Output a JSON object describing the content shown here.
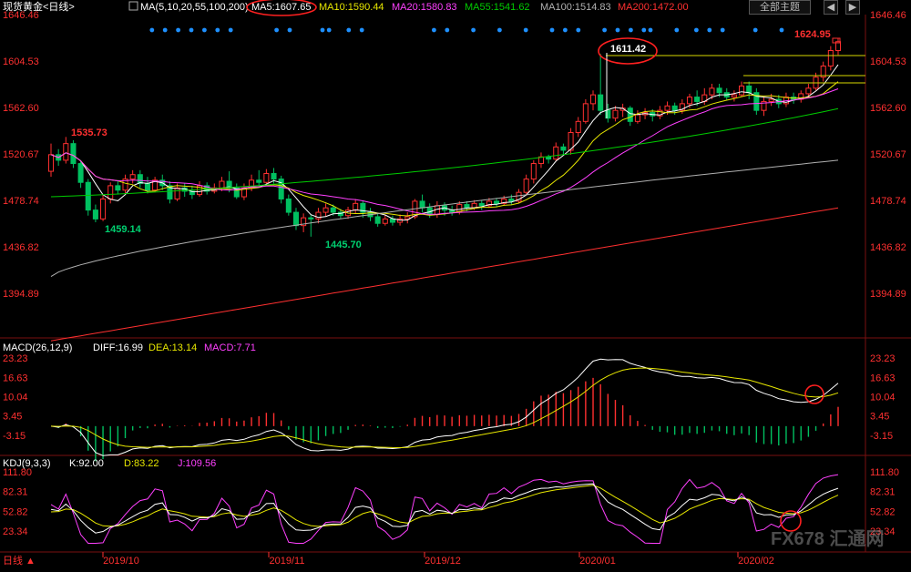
{
  "header": {
    "title": "现货黄金<日线>",
    "ma_indicator": "MA(5,10,20,55,100,200)",
    "ma_values": [
      {
        "text": "MA5:1607.65",
        "color": "#ffffff"
      },
      {
        "text": "MA10:1590.44",
        "color": "#e6e600"
      },
      {
        "text": "MA20:1580.83",
        "color": "#ff40ff"
      },
      {
        "text": "MA55:1541.62",
        "color": "#00cc00"
      },
      {
        "text": "MA100:1514.83",
        "color": "#b0b0b0"
      },
      {
        "text": "MA200:1472.00",
        "color": "#ff3030"
      }
    ],
    "theme_button": "全部主题",
    "nav_left": "◀",
    "nav_right": "▶"
  },
  "macd_header": {
    "name": "MACD(26,12,9)",
    "diff": "DIFF:16.99",
    "dea": "DEA:13.14",
    "macd": "MACD:7.71"
  },
  "kdj_header": {
    "name": "KDJ(9,3,3)",
    "k": "K:92.00",
    "d": "D:83.22",
    "j": "J:109.56"
  },
  "footer": {
    "period": "日线 ▲",
    "watermark": "FX678 汇通网"
  },
  "colors": {
    "up": "#ff3030",
    "down": "#00c060",
    "ma5": "#ffffff",
    "ma10": "#e6e600",
    "ma20": "#ff40ff",
    "ma55": "#00cc00",
    "ma100": "#b0b0b0",
    "ma200": "#ff3030",
    "axis": "#ff3030",
    "annot": "#ff3030"
  },
  "chart_data": [
    {
      "type": "candlestick",
      "title": "现货黄金<日线>",
      "y_ticks": [
        1646.46,
        1604.53,
        1562.6,
        1520.67,
        1478.74,
        1436.82,
        1394.89
      ],
      "x_ticks": [
        "2019/10",
        "2019/11",
        "2019/12",
        "2020/01",
        "2020/02"
      ],
      "annotations": [
        {
          "label": "1535.73"
        },
        {
          "label": "1459.14"
        },
        {
          "label": "1445.70"
        },
        {
          "label": "1611.42"
        },
        {
          "label": "1624.95"
        }
      ],
      "candles": [
        [
          1505,
          1520,
          1500,
          1530
        ],
        [
          1520,
          1515,
          1510,
          1525
        ],
        [
          1515,
          1530,
          1512,
          1536
        ],
        [
          1530,
          1512,
          1508,
          1533
        ],
        [
          1512,
          1495,
          1490,
          1515
        ],
        [
          1495,
          1470,
          1465,
          1498
        ],
        [
          1470,
          1462,
          1459,
          1475
        ],
        [
          1462,
          1480,
          1460,
          1484
        ],
        [
          1480,
          1492,
          1476,
          1495
        ],
        [
          1492,
          1488,
          1484,
          1497
        ],
        [
          1488,
          1498,
          1485,
          1502
        ],
        [
          1498,
          1502,
          1494,
          1506
        ],
        [
          1502,
          1494,
          1490,
          1506
        ],
        [
          1494,
          1488,
          1485,
          1500
        ],
        [
          1488,
          1497,
          1486,
          1500
        ],
        [
          1497,
          1492,
          1488,
          1502
        ],
        [
          1492,
          1480,
          1476,
          1496
        ],
        [
          1480,
          1490,
          1478,
          1494
        ],
        [
          1490,
          1487,
          1482,
          1494
        ],
        [
          1487,
          1484,
          1480,
          1492
        ],
        [
          1484,
          1492,
          1482,
          1496
        ],
        [
          1492,
          1487,
          1484,
          1495
        ],
        [
          1487,
          1490,
          1485,
          1494
        ],
        [
          1490,
          1496,
          1487,
          1500
        ],
        [
          1496,
          1490,
          1486,
          1505
        ],
        [
          1490,
          1482,
          1480,
          1494
        ],
        [
          1482,
          1490,
          1479,
          1494
        ],
        [
          1490,
          1497,
          1487,
          1502
        ],
        [
          1497,
          1495,
          1491,
          1506
        ],
        [
          1495,
          1503,
          1492,
          1507
        ],
        [
          1503,
          1498,
          1494,
          1508
        ],
        [
          1498,
          1480,
          1476,
          1501
        ],
        [
          1480,
          1468,
          1465,
          1484
        ],
        [
          1468,
          1456,
          1452,
          1472
        ],
        [
          1456,
          1463,
          1450,
          1467
        ],
        [
          1463,
          1462,
          1446,
          1466
        ],
        [
          1462,
          1468,
          1458,
          1472
        ],
        [
          1468,
          1472,
          1464,
          1476
        ],
        [
          1472,
          1468,
          1465,
          1475
        ],
        [
          1468,
          1465,
          1462,
          1471
        ],
        [
          1465,
          1470,
          1462,
          1473
        ],
        [
          1470,
          1476,
          1467,
          1480
        ],
        [
          1476,
          1468,
          1463,
          1478
        ],
        [
          1468,
          1464,
          1460,
          1472
        ],
        [
          1464,
          1458,
          1455,
          1467
        ],
        [
          1458,
          1462,
          1456,
          1466
        ],
        [
          1462,
          1459,
          1456,
          1465
        ],
        [
          1459,
          1462,
          1456,
          1466
        ],
        [
          1462,
          1464,
          1458,
          1468
        ],
        [
          1464,
          1478,
          1462,
          1480
        ],
        [
          1478,
          1472,
          1468,
          1484
        ],
        [
          1472,
          1466,
          1463,
          1476
        ],
        [
          1466,
          1474,
          1463,
          1478
        ],
        [
          1474,
          1470,
          1465,
          1477
        ],
        [
          1470,
          1468,
          1465,
          1474
        ],
        [
          1468,
          1475,
          1466,
          1478
        ],
        [
          1475,
          1472,
          1469,
          1478
        ],
        [
          1472,
          1476,
          1470,
          1479
        ],
        [
          1476,
          1474,
          1470,
          1479
        ],
        [
          1474,
          1478,
          1472,
          1481
        ],
        [
          1478,
          1476,
          1473,
          1481
        ],
        [
          1476,
          1480,
          1474,
          1483
        ],
        [
          1480,
          1478,
          1475,
          1484
        ],
        [
          1478,
          1486,
          1476,
          1489
        ],
        [
          1486,
          1498,
          1484,
          1502
        ],
        [
          1498,
          1512,
          1494,
          1515
        ],
        [
          1512,
          1518,
          1508,
          1522
        ],
        [
          1518,
          1516,
          1512,
          1520
        ],
        [
          1516,
          1527,
          1514,
          1531
        ],
        [
          1527,
          1524,
          1520,
          1530
        ],
        [
          1524,
          1540,
          1520,
          1544
        ],
        [
          1540,
          1550,
          1536,
          1554
        ],
        [
          1550,
          1566,
          1548,
          1570
        ],
        [
          1566,
          1574,
          1560,
          1578
        ],
        [
          1574,
          1560,
          1556,
          1611
        ],
        [
          1560,
          1553,
          1549,
          1566
        ],
        [
          1553,
          1560,
          1550,
          1564
        ],
        [
          1560,
          1562,
          1554,
          1566
        ],
        [
          1562,
          1550,
          1546,
          1564
        ],
        [
          1550,
          1556,
          1548,
          1560
        ],
        [
          1556,
          1558,
          1552,
          1562
        ],
        [
          1558,
          1555,
          1550,
          1561
        ],
        [
          1555,
          1560,
          1552,
          1564
        ],
        [
          1560,
          1564,
          1556,
          1568
        ],
        [
          1564,
          1560,
          1556,
          1567
        ],
        [
          1560,
          1566,
          1557,
          1570
        ],
        [
          1566,
          1572,
          1562,
          1575
        ],
        [
          1572,
          1568,
          1564,
          1578
        ],
        [
          1568,
          1574,
          1565,
          1580
        ],
        [
          1574,
          1580,
          1570,
          1584
        ],
        [
          1580,
          1576,
          1572,
          1584
        ],
        [
          1576,
          1572,
          1569,
          1580
        ],
        [
          1572,
          1574,
          1568,
          1578
        ],
        [
          1574,
          1582,
          1572,
          1586
        ],
        [
          1582,
          1576,
          1570,
          1586
        ],
        [
          1576,
          1560,
          1556,
          1580
        ],
        [
          1560,
          1568,
          1555,
          1572
        ],
        [
          1568,
          1570,
          1564,
          1575
        ],
        [
          1570,
          1566,
          1562,
          1574
        ],
        [
          1566,
          1572,
          1563,
          1576
        ],
        [
          1572,
          1570,
          1566,
          1576
        ],
        [
          1570,
          1575,
          1567,
          1578
        ],
        [
          1575,
          1580,
          1572,
          1584
        ],
        [
          1580,
          1590,
          1578,
          1594
        ],
        [
          1590,
          1600,
          1586,
          1604
        ],
        [
          1600,
          1614,
          1596,
          1618
        ],
        [
          1614,
          1622,
          1610,
          1625
        ]
      ]
    },
    {
      "type": "bar+line",
      "title": "MACD(26,12,9)",
      "y_ticks": [
        23.23,
        16.63,
        10.04,
        3.45,
        -3.15
      ],
      "series": [
        {
          "name": "DIFF"
        },
        {
          "name": "DEA"
        },
        {
          "name": "MACD"
        }
      ]
    },
    {
      "type": "line",
      "title": "KDJ(9,3,3)",
      "y_ticks": [
        111.8,
        82.31,
        52.82,
        23.34
      ],
      "series": [
        {
          "name": "K"
        },
        {
          "name": "D"
        },
        {
          "name": "J"
        }
      ]
    }
  ]
}
